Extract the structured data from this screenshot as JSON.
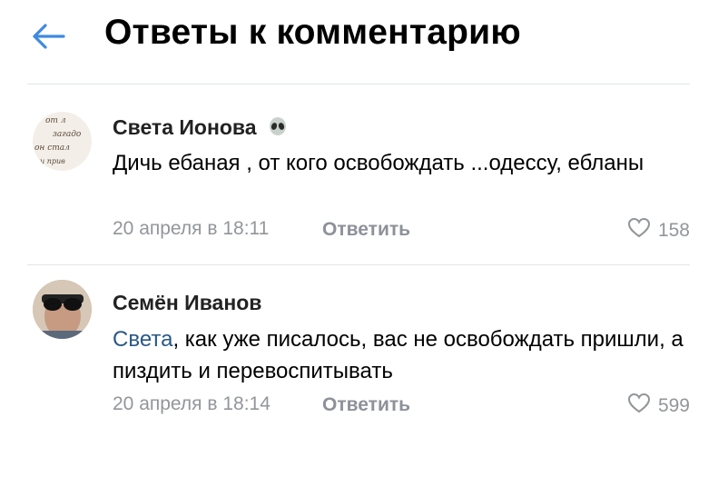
{
  "header": {
    "title": "Ответы к комментарию"
  },
  "comments": [
    {
      "author": "Света Ионова",
      "avatar_lines": [
        "от л",
        "загадо",
        "он стал",
        "и прив"
      ],
      "text": "Дичь ебаная , от кого освобождать ...одессу, ебланы",
      "date": "20 апреля в 18:11",
      "reply_label": "Ответить",
      "likes": "158"
    },
    {
      "author": "Семён Иванов",
      "mention": "Света",
      "text": ", как уже писалось, вас не освобождать пришли, а пиздить и перевоспитывать",
      "date": "20 апреля в 18:14",
      "reply_label": "Ответить",
      "likes": "599"
    }
  ],
  "colors": {
    "link": "#2a5885",
    "meta": "#939699",
    "back_arrow": "#3f8ae0"
  },
  "icons": [
    "back-arrow-icon",
    "alien-emoji-icon",
    "heart-icon"
  ]
}
